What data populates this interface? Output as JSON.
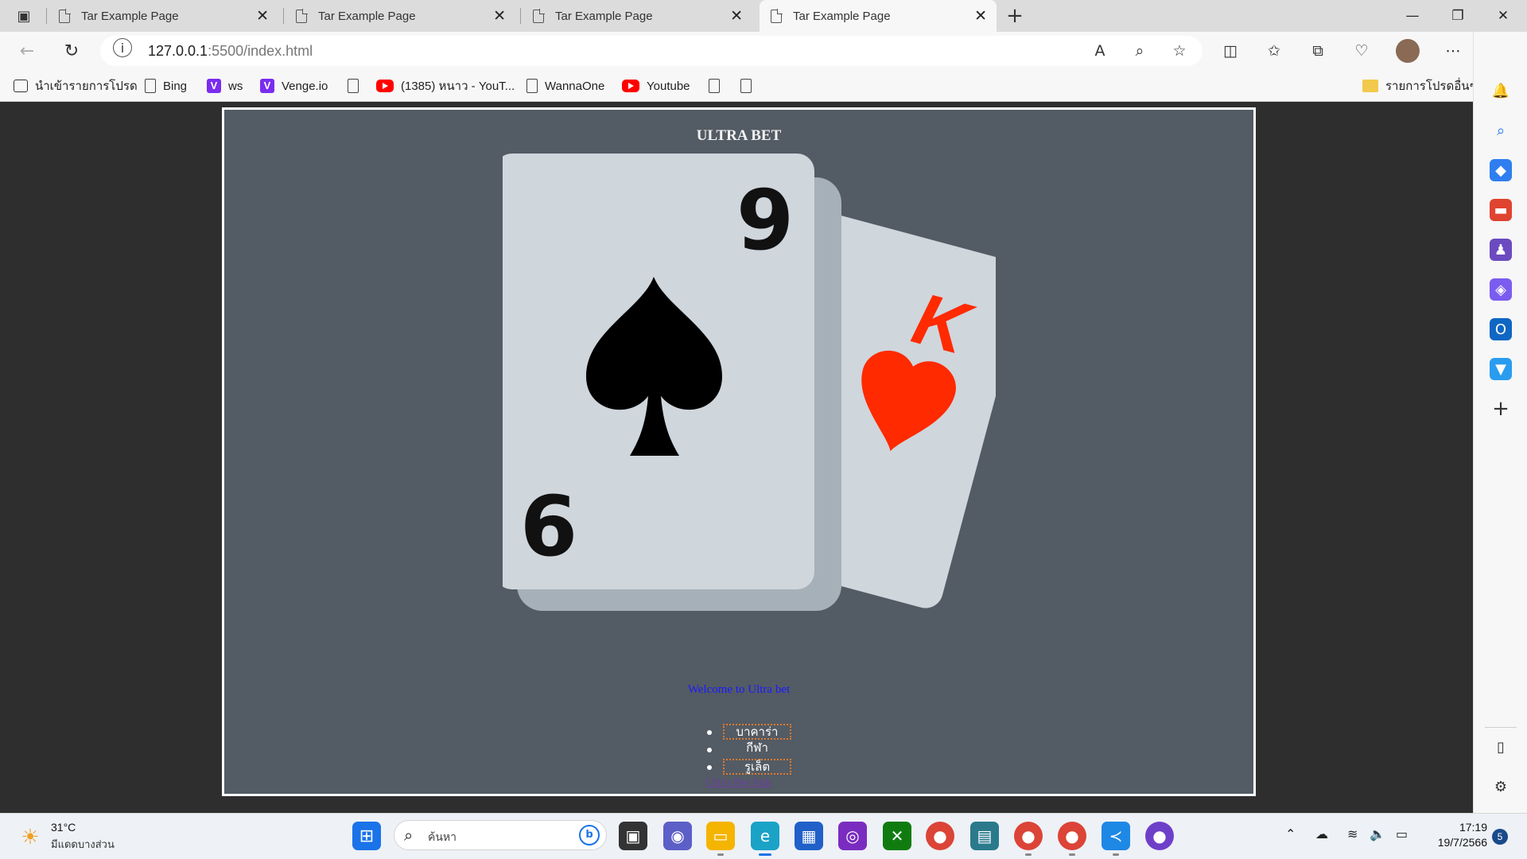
{
  "browser": {
    "tabs": [
      {
        "title": "Tar Example Page"
      },
      {
        "title": "Tar Example Page"
      },
      {
        "title": "Tar Example Page"
      },
      {
        "title": "Tar Example Page"
      }
    ],
    "active_tab": 3,
    "address": {
      "host": "127.0.0.1",
      "path": ":5500/index.html"
    },
    "bookmarks": [
      {
        "label": "นำเข้ารายการโปรด",
        "icon": "import-icon"
      },
      {
        "label": "Bing",
        "icon": "page-icon"
      },
      {
        "label": "ws",
        "icon": "venge-icon"
      },
      {
        "label": "Venge.io",
        "icon": "venge-icon"
      },
      {
        "label": "",
        "icon": "page-icon"
      },
      {
        "label": "(1385) หนาว - YouT...",
        "icon": "youtube-icon"
      },
      {
        "label": "",
        "icon": "page-icon"
      },
      {
        "label": "WannaOne",
        "icon": "page-icon"
      },
      {
        "label": "Youtube",
        "icon": "youtube-icon"
      },
      {
        "label": "",
        "icon": "page-icon"
      },
      {
        "label": "",
        "icon": "page-icon"
      }
    ],
    "other_favorites": "รายการโปรดอื่นๆ"
  },
  "page": {
    "title": "ULTRA BET",
    "card_front": {
      "top_rank": "9",
      "bottom_rank": "6",
      "suit": "spade-icon"
    },
    "card_back": {
      "rank": "K",
      "suit": "heart-icon"
    },
    "welcome": "Welcome to Ultra bet",
    "menu": [
      {
        "label": "บาคาร่า",
        "boxed": true
      },
      {
        "label": "กีฬา",
        "boxed": false
      },
      {
        "label": "รูเล็ต",
        "boxed": true
      }
    ],
    "link": "Ultra Bet link"
  },
  "taskbar": {
    "weather_temp": "31°C",
    "weather_desc": "มีแดดบางส่วน",
    "search_placeholder": "ค้นหา",
    "time": "17:19",
    "date": "19/7/2566",
    "notifications": "5"
  },
  "colors": {
    "page_bg": "#535b64",
    "card_light": "#cfd6dc",
    "card_shadow": "#a5b0b8",
    "heart_red": "#ff2a00",
    "heart_dark": "#d42200",
    "link_blue": "#1a1aff",
    "link_visited": "#6b3fa0",
    "menu_border": "#e07a2f"
  }
}
